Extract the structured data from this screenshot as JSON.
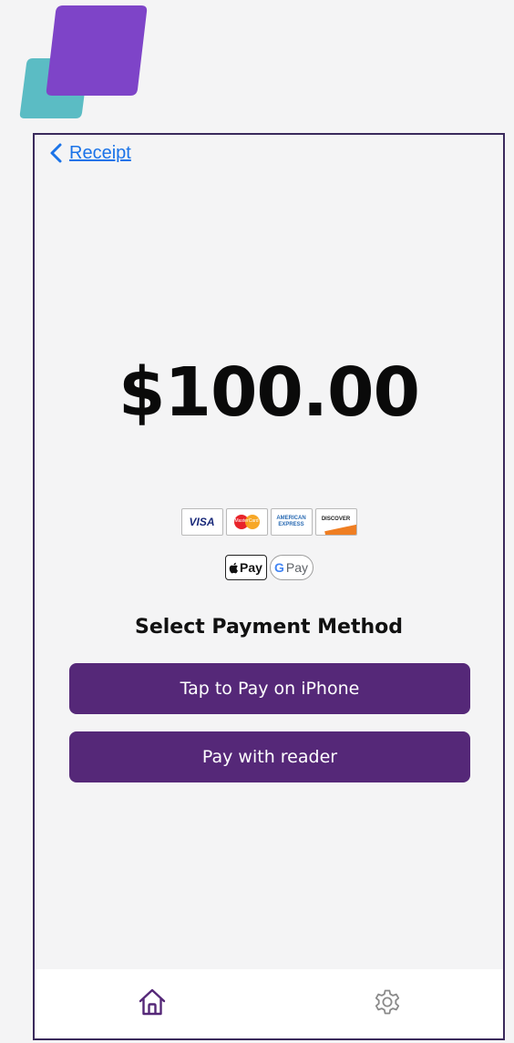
{
  "brand": {
    "primary_color": "#552878",
    "secondary_color": "#5bbcc4",
    "logo_color": "#7e44c8"
  },
  "nav": {
    "back_label": "Receipt",
    "back_icon": "chevron-left-icon"
  },
  "payment": {
    "amount": "$100.00",
    "accepted_cards": [
      {
        "name": "visa",
        "text": "VISA"
      },
      {
        "name": "mastercard",
        "text": "MasterCard"
      },
      {
        "name": "american-express",
        "text": "AMERICAN EXPRESS"
      },
      {
        "name": "discover",
        "text": "DISCOVER"
      }
    ],
    "wallets": {
      "apple_pay": "Pay",
      "google_pay_g": "G",
      "google_pay": "Pay"
    },
    "section_title": "Select Payment Method",
    "buttons": {
      "tap_to_pay": "Tap to Pay on iPhone",
      "pay_with_reader": "Pay with reader"
    }
  },
  "tabbar": {
    "items": [
      {
        "name": "home",
        "icon": "home-icon",
        "active": true
      },
      {
        "name": "settings",
        "icon": "gear-icon",
        "active": false
      }
    ]
  }
}
